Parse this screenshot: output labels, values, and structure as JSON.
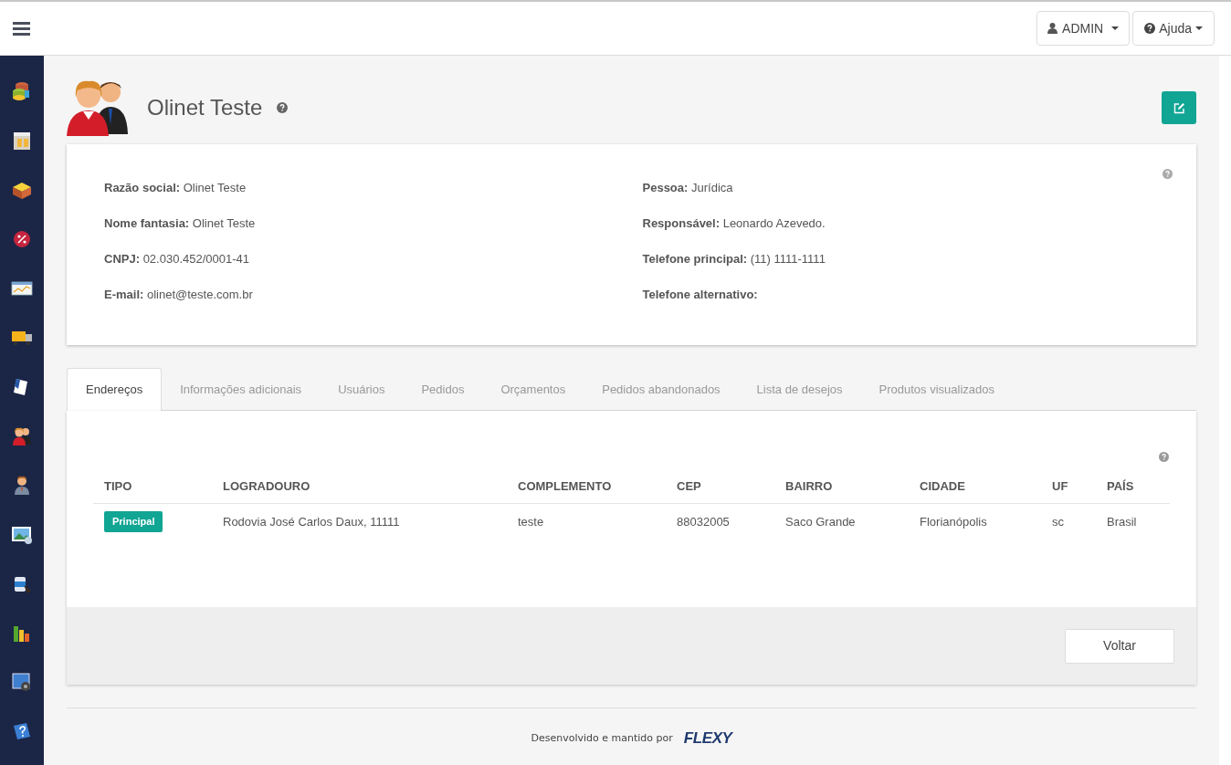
{
  "topbar": {
    "user_menu": "ADMIN",
    "help_menu": "Ajuda"
  },
  "sidebar": {
    "items": [
      {
        "kind": "database"
      },
      {
        "kind": "store"
      },
      {
        "kind": "box"
      },
      {
        "kind": "percent"
      },
      {
        "kind": "chart"
      },
      {
        "kind": "truck"
      },
      {
        "kind": "document"
      },
      {
        "kind": "people"
      },
      {
        "kind": "person"
      },
      {
        "kind": "image"
      },
      {
        "kind": "bucket"
      },
      {
        "kind": "bars"
      },
      {
        "kind": "settings"
      },
      {
        "kind": "help"
      }
    ]
  },
  "header": {
    "title": "Olinet Teste"
  },
  "details": {
    "left": [
      {
        "label": "Razão social:",
        "value": "Olinet Teste"
      },
      {
        "label": "Nome fantasia:",
        "value": "Olinet Teste"
      },
      {
        "label": "CNPJ:",
        "value": "02.030.452/0001-41"
      },
      {
        "label": "E-mail:",
        "value": "olinet@teste.com.br"
      }
    ],
    "right": [
      {
        "label": "Pessoa:",
        "value": "Jurídica"
      },
      {
        "label": "Responsável:",
        "value": "Leonardo Azevedo."
      },
      {
        "label": "Telefone principal:",
        "value": "(11) 1111-1111"
      },
      {
        "label": "Telefone alternativo:"
      }
    ]
  },
  "tabs": [
    {
      "label": "Endereços",
      "selected": true
    },
    {
      "label": "Informações adicionais",
      "selected": false
    },
    {
      "label": "Usuários",
      "selected": false
    },
    {
      "label": "Pedidos",
      "selected": false
    },
    {
      "label": "Orçamentos",
      "selected": false
    },
    {
      "label": "Pedidos abandonados",
      "selected": false
    },
    {
      "label": "Lista de desejos",
      "selected": false
    },
    {
      "label": "Produtos visualizados",
      "selected": false
    }
  ],
  "table": {
    "columns": [
      "TIPO",
      "LOGRADOURO",
      "COMPLEMENTO",
      "CEP",
      "BAIRRO",
      "CIDADE",
      "UF",
      "PAÍS"
    ],
    "rows": [
      {
        "cells": [
          "Principal",
          "Rodovia José Carlos Daux, 11111",
          "teste",
          "88032005",
          "Saco Grande",
          "Florianópolis",
          "sc",
          "Brasil"
        ]
      }
    ]
  },
  "back_button": "Voltar",
  "footer": {
    "text": "Desenvolvido e mantido por",
    "brand": "FLEXY"
  }
}
